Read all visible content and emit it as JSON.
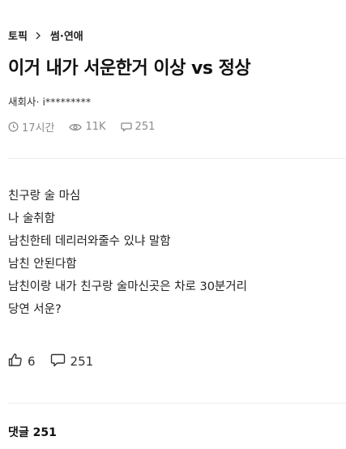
{
  "breadcrumb": {
    "root": "토픽",
    "category": "썸·연애"
  },
  "post": {
    "title": "이거 내가 서운한거 이상 vs 정상",
    "author": "새회사· i*********",
    "time": "17시간",
    "views": "11K",
    "comment_count": "251",
    "body": [
      "친구랑 술 마심",
      "나 술취함",
      "남친한테 데리러와줄수 있냐 말함",
      "남친 안된다함",
      "남친이랑 내가 친구랑 술마신곳은 차로 30분거리",
      "당연 서운?"
    ]
  },
  "actions": {
    "likes": "6",
    "comments": "251"
  },
  "comments_section": {
    "heading": "댓글 251"
  },
  "icons": {
    "breadcrumb_separator": "chevron-right-icon",
    "time": "clock-icon",
    "views": "eye-icon",
    "comments": "comment-bubble-icon",
    "like": "thumbs-up-icon"
  }
}
